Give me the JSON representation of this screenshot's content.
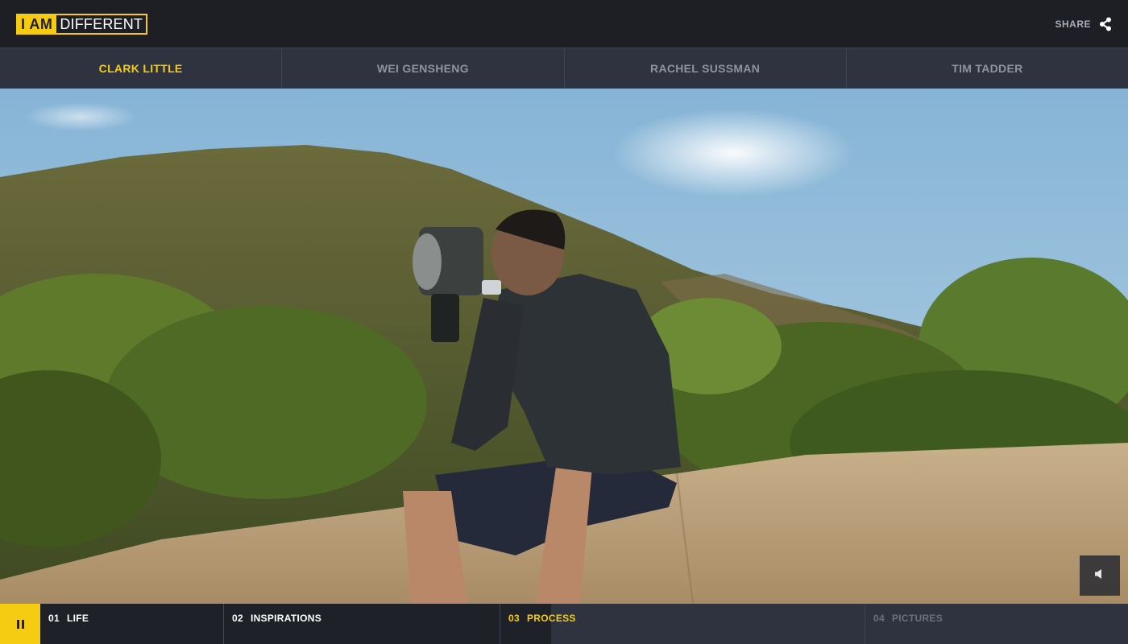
{
  "header": {
    "logo_strong": "I AM",
    "logo_rest": "DIFFERENT",
    "share_label": "SHARE",
    "share_icon": "share-icon"
  },
  "nav": {
    "tabs": [
      {
        "label": "CLARK LITTLE",
        "active": true
      },
      {
        "label": "WEI GENSHENG",
        "active": false
      },
      {
        "label": "RACHEL SUSSMAN",
        "active": false
      },
      {
        "label": "TIM TADDER",
        "active": false
      }
    ]
  },
  "video": {
    "volume_icon": "volume-icon"
  },
  "player": {
    "pause_icon": "pause-icon",
    "chapters": [
      {
        "num": "01",
        "title": "LIFE"
      },
      {
        "num": "02",
        "title": "INSPIRATIONS"
      },
      {
        "num": "03",
        "title": "PROCESS"
      },
      {
        "num": "04",
        "title": "PICTURES"
      }
    ],
    "current_chapter_progress": 0.14
  },
  "colors": {
    "accent": "#f5cc12",
    "header_bg": "#1d1f25",
    "bar_bg": "#2f3340"
  }
}
